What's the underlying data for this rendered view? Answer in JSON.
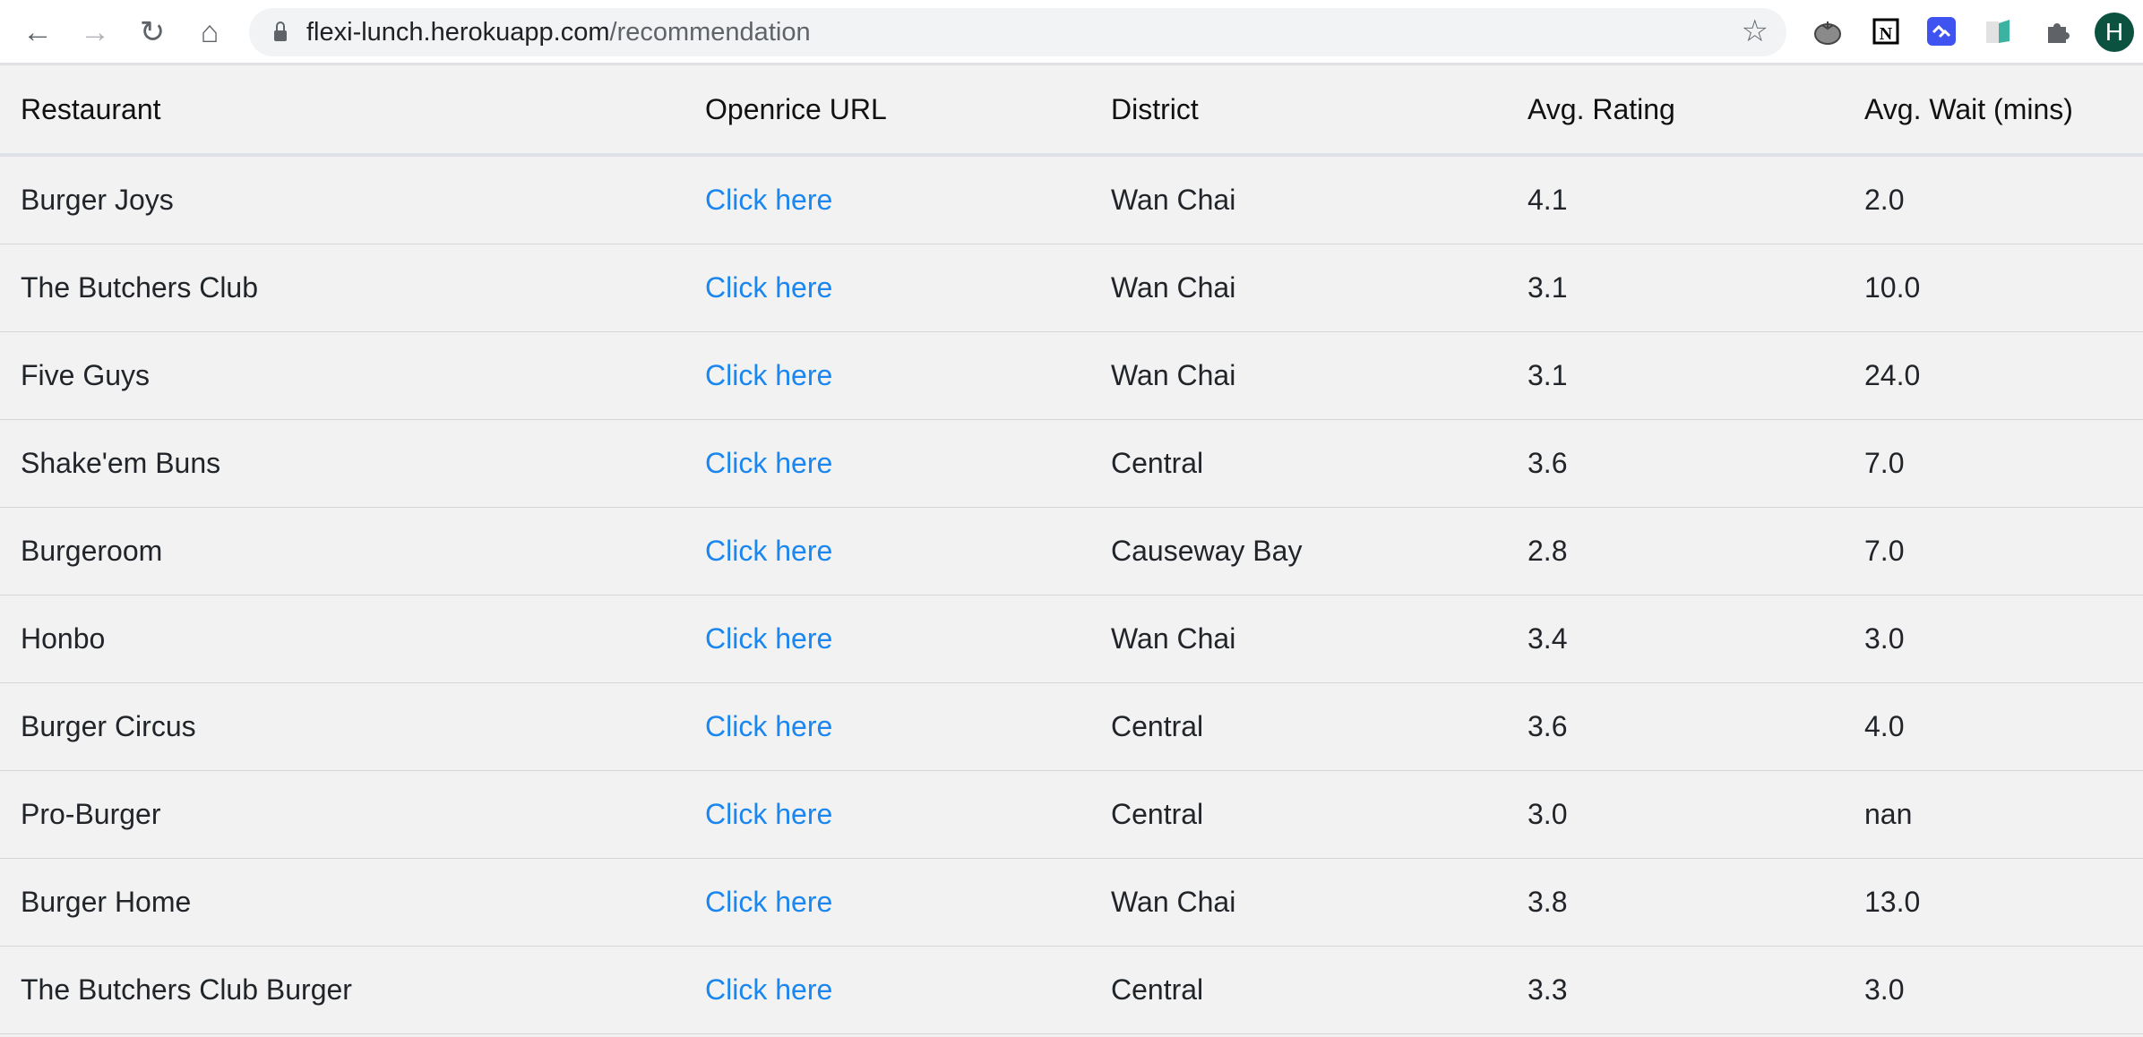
{
  "browser": {
    "url_host": "flexi-lunch.herokuapp.com",
    "url_path": "/recommendation",
    "extensions": [
      "tomato-icon",
      "notion-icon",
      "link-extension-icon",
      "reader-icon",
      "puzzle-icon"
    ],
    "avatar_letter": "H",
    "avatar_color": "#0b5240"
  },
  "table": {
    "headers": [
      "Restaurant",
      "Openrice URL",
      "District",
      "Avg. Rating",
      "Avg. Wait (mins)"
    ],
    "link_color": "#1a86f0",
    "rows": [
      {
        "restaurant": "Burger Joys",
        "url": "Click here",
        "district": "Wan Chai",
        "rating": "4.1",
        "wait": "2.0"
      },
      {
        "restaurant": "The Butchers Club",
        "url": "Click here",
        "district": "Wan Chai",
        "rating": "3.1",
        "wait": "10.0"
      },
      {
        "restaurant": "Five Guys",
        "url": "Click here",
        "district": "Wan Chai",
        "rating": "3.1",
        "wait": "24.0"
      },
      {
        "restaurant": "Shake'em Buns",
        "url": "Click here",
        "district": "Central",
        "rating": "3.6",
        "wait": "7.0"
      },
      {
        "restaurant": "Burgeroom",
        "url": "Click here",
        "district": "Causeway Bay",
        "rating": "2.8",
        "wait": "7.0"
      },
      {
        "restaurant": "Honbo",
        "url": "Click here",
        "district": "Wan Chai",
        "rating": "3.4",
        "wait": "3.0"
      },
      {
        "restaurant": "Burger Circus",
        "url": "Click here",
        "district": "Central",
        "rating": "3.6",
        "wait": "4.0"
      },
      {
        "restaurant": "Pro-Burger",
        "url": "Click here",
        "district": "Central",
        "rating": "3.0",
        "wait": "nan"
      },
      {
        "restaurant": "Burger Home",
        "url": "Click here",
        "district": "Wan Chai",
        "rating": "3.8",
        "wait": "13.0"
      },
      {
        "restaurant": "The Butchers Club Burger",
        "url": "Click here",
        "district": "Central",
        "rating": "3.3",
        "wait": "3.0"
      }
    ]
  }
}
